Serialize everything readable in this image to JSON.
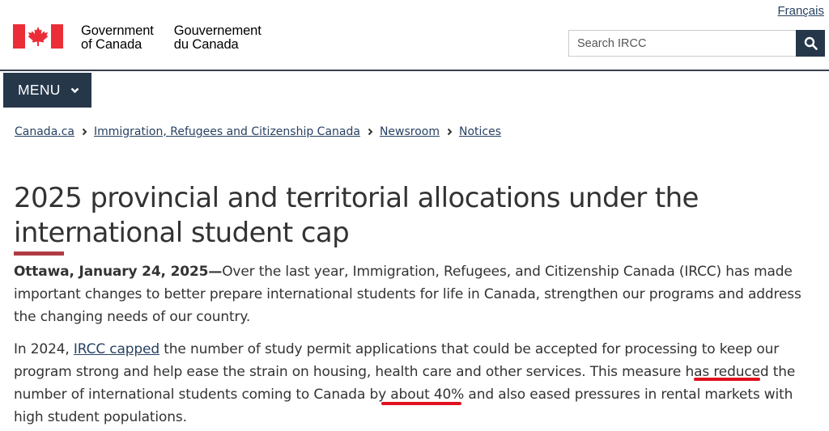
{
  "header": {
    "language_toggle": "Français",
    "signature_en_line1": "Government",
    "signature_en_line2": "of Canada",
    "signature_fr_line1": "Gouvernement",
    "signature_fr_line2": "du Canada",
    "search_placeholder": "Search IRCC",
    "menu_label": "MENU"
  },
  "breadcrumb": [
    "Canada.ca",
    "Immigration, Refugees and Citizenship Canada",
    "Newsroom",
    "Notices"
  ],
  "article": {
    "title": "2025 provincial and territorial allocations under the international student cap",
    "p1_dateline": "Ottawa, January 24, 2025—",
    "p1_text": "Over the last year, Immigration, Refugees, and Citizenship Canada (IRCC) has made important changes to better prepare international students for life in Canada, strengthen our programs and address the changing needs of our country.",
    "p2_part1": "In 2024, ",
    "p2_link": "IRCC capped",
    "p2_part2": " the number of study permit applications that could be accepted for processing to keep our program strong and help ease the strain on housing, health care and other services. This measure has ",
    "p2_reduced": "reduced",
    "p2_part3": " the number of international students coming to Canada by ",
    "p2_about": "about 40%",
    "p2_part4": " and also eased pressures in rental markets with high student populations."
  },
  "colors": {
    "flag_red": "#eb2d37",
    "nav_dark": "#26374a",
    "link": "#284162",
    "title_accent": "#af3c43",
    "annotation_red": "#e0101e"
  }
}
